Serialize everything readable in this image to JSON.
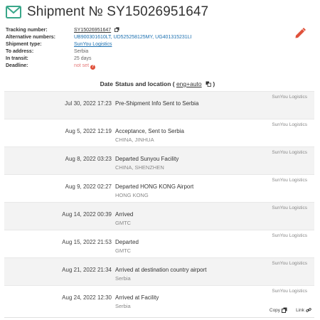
{
  "header": {
    "title": "Shipment № SY15026951647",
    "icon": "mail-icon",
    "accent": "#3aa78a"
  },
  "info": {
    "tracking_label": "Tracking number:",
    "tracking_value": "SY15026951647",
    "alt_label": "Alternative numbers:",
    "alt_value": "UB900301610LT, UD525258125MY, UG401315231LI",
    "type_label": "Shipment type:",
    "type_value": "SunYou Logistics",
    "to_label": "To address:",
    "to_value": "Serbia",
    "transit_label": "In transit:",
    "transit_value": "25 days",
    "deadline_label": "Deadline:",
    "deadline_value": "not set",
    "deadline_help": "?"
  },
  "table": {
    "date_header": "Date",
    "status_header_prefix": "Status and location ( ",
    "lang_label": "eng+auto",
    "status_header_suffix": " )"
  },
  "events": [
    {
      "carrier": "SunYou Logistics",
      "date": "Jul 30, 2022 17:23",
      "status": "Pre-Shipment Info Sent to Serbia",
      "location": ""
    },
    {
      "carrier": "SunYou Logistics",
      "date": "Aug 5, 2022 12:19",
      "status": "Acceptance, Sent to Serbia",
      "location": "CHINA, JINHUA"
    },
    {
      "carrier": "SunYou Logistics",
      "date": "Aug 8, 2022 03:23",
      "status": "Departed Sunyou Facility",
      "location": "CHINA, SHENZHEN"
    },
    {
      "carrier": "SunYou Logistics",
      "date": "Aug 9, 2022 02:27",
      "status": "Departed HONG KONG Airport",
      "location": "HONG KONG"
    },
    {
      "carrier": "SunYou Logistics",
      "date": "Aug 14, 2022 00:39",
      "status": "Arrived",
      "location": "GMTC"
    },
    {
      "carrier": "SunYou Logistics",
      "date": "Aug 15, 2022 21:53",
      "status": "Departed",
      "location": "GMTC"
    },
    {
      "carrier": "SunYou Logistics",
      "date": "Aug 21, 2022 21:34",
      "status": "Arrived at destination country airport",
      "location": "Serbia"
    },
    {
      "carrier": "SunYou Logistics",
      "date": "Aug 24, 2022 12:30",
      "status": "Arrived at Facility",
      "location": "Serbia"
    }
  ],
  "footer": {
    "copy_label": "Copy",
    "link_label": "Link"
  },
  "colors": {
    "edit_icon": "#e0513b",
    "link": "#1a6fb0",
    "row_alt": "#f3f3f3"
  }
}
